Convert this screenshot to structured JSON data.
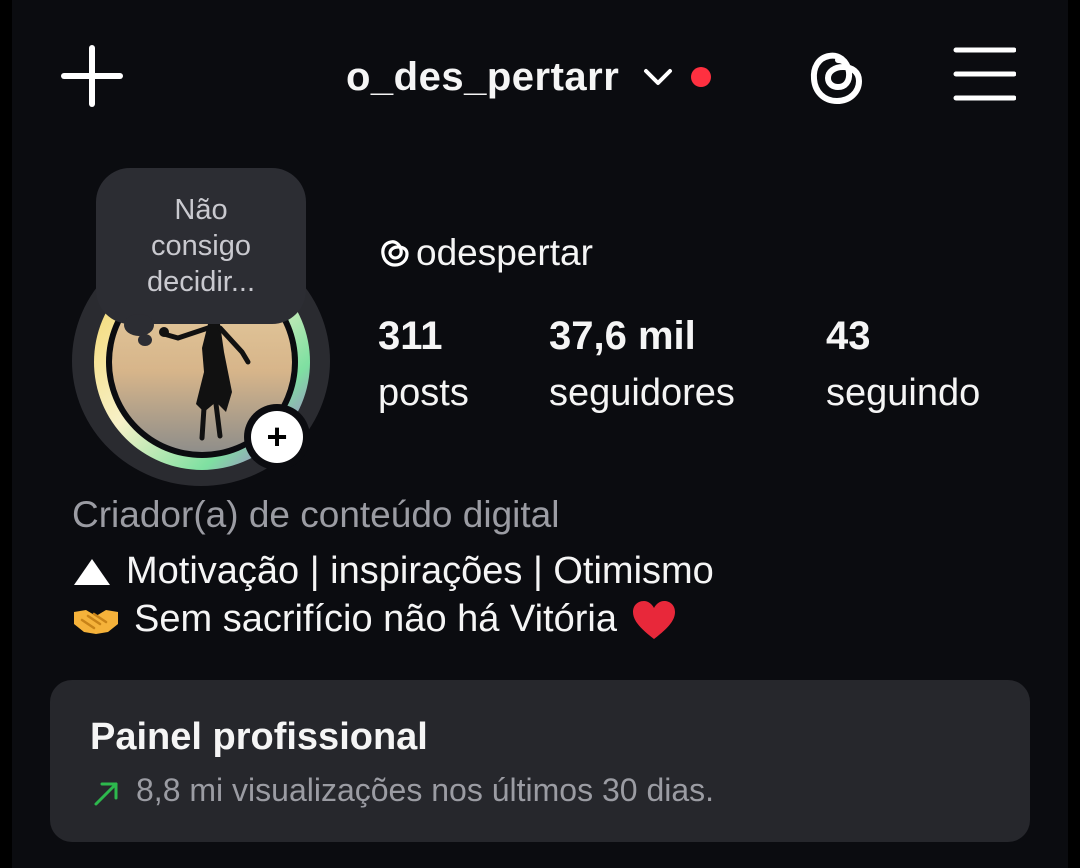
{
  "header": {
    "username": "o_des_pertarr",
    "icons": [
      "plus-icon",
      "chevron-down-icon",
      "notification-dot",
      "threads-icon",
      "menu-icon"
    ],
    "notification_color": "#ff3040"
  },
  "note": {
    "text_line1": "Não",
    "text_line2": "consigo",
    "text_line3": "decidir..."
  },
  "profile": {
    "threads_handle": "odespertar",
    "stats": [
      {
        "value": "311",
        "label": "posts"
      },
      {
        "value": "37,6 mil",
        "label": "seguidores"
      },
      {
        "value": "43",
        "label": "seguindo"
      }
    ],
    "category": "Criador(a) de conteúdo digital",
    "bio_line1": "Motivação | inspirações | Otimismo",
    "bio_line2": "Sem sacrifício não há Vitória"
  },
  "dashboard": {
    "title": "Painel profissional",
    "subtitle": "8,8 mi visualizações nos últimos 30 dias.",
    "trend_color": "#2db84d"
  }
}
